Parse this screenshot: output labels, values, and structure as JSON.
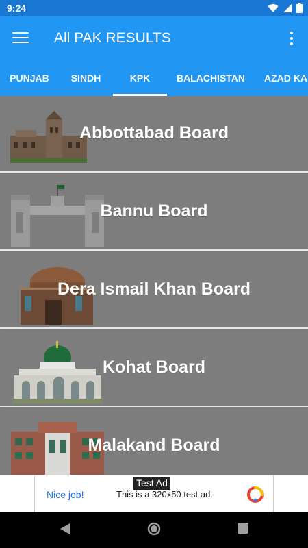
{
  "status_bar": {
    "time": "9:24"
  },
  "app_bar": {
    "title": "All PAK RESULTS"
  },
  "tabs": [
    {
      "label": "PUNJAB"
    },
    {
      "label": "SINDH"
    },
    {
      "label": "KPK",
      "selected": true
    },
    {
      "label": "BALACHISTAN"
    },
    {
      "label": "AZAD KA"
    }
  ],
  "boards": [
    {
      "label": "Abbottabad Board"
    },
    {
      "label": "Bannu Board"
    },
    {
      "label": "Dera Ismail Khan Board"
    },
    {
      "label": "Kohat Board"
    },
    {
      "label": "Malakand Board"
    }
  ],
  "ad": {
    "tag": "Test Ad",
    "headline": "Nice job!",
    "body": "This is a 320x50 test ad."
  },
  "colors": {
    "primary": "#2196F3",
    "primary_dark": "#1976D2",
    "list_background": "#7d7d7d"
  }
}
